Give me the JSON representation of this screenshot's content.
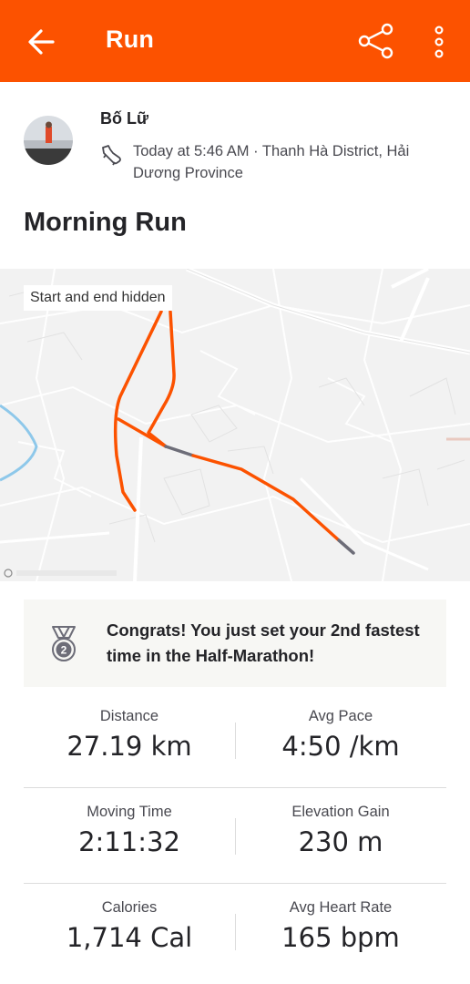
{
  "header": {
    "title": "Run",
    "back_icon": "arrow-left-icon",
    "share_icon": "share-icon",
    "more_icon": "more-vertical-icon",
    "color": "#fc5200"
  },
  "athlete": {
    "name": "Bố Lữ",
    "activity_icon": "shoe-icon",
    "meta": "Today at 5:46 AM · Thanh Hà District, Hải Dương Province"
  },
  "activity": {
    "title": "Morning Run"
  },
  "map": {
    "badge": "Start and end hidden",
    "route_color": "#fc5200",
    "hidden_segment_color": "#6d6d78"
  },
  "achievement": {
    "icon": "medal-icon",
    "rank": "2",
    "text": "Congrats! You just set your 2nd fastest time in the Half-Marathon!"
  },
  "stats": [
    {
      "left": {
        "label": "Distance",
        "value": "27.19 km"
      },
      "right": {
        "label": "Avg Pace",
        "value": "4:50 /km"
      }
    },
    {
      "left": {
        "label": "Moving Time",
        "value": "2:11:32"
      },
      "right": {
        "label": "Elevation Gain",
        "value": "230 m"
      }
    },
    {
      "left": {
        "label": "Calories",
        "value": "1,714 Cal"
      },
      "right": {
        "label": "Avg Heart Rate",
        "value": "165 bpm"
      }
    }
  ]
}
